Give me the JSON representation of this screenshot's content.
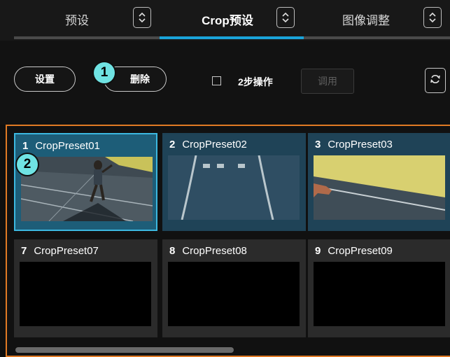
{
  "tabs": [
    {
      "label": "预设"
    },
    {
      "label": "Crop预设",
      "active": true
    },
    {
      "label": "图像调整"
    }
  ],
  "toolbar": {
    "settings_label": "设置",
    "delete_label": "删除",
    "two_step_label": "2步操作",
    "two_step_checked": false,
    "call_label": "调用"
  },
  "callouts": [
    "1",
    "2"
  ],
  "presets": [
    {
      "number": "1",
      "name": "CropPreset01",
      "selected": true,
      "thumbnail": "sprinter-start"
    },
    {
      "number": "2",
      "name": "CropPreset02",
      "thumbnail": "track-lanes"
    },
    {
      "number": "3",
      "name": "CropPreset03",
      "thumbnail": "track-closeup"
    },
    {
      "number": "7",
      "name": "CropPreset07",
      "thumbnail": "empty"
    },
    {
      "number": "8",
      "name": "CropPreset08",
      "thumbnail": "empty"
    },
    {
      "number": "9",
      "name": "CropPreset09",
      "thumbnail": "empty"
    }
  ],
  "colors": {
    "accent": "#1aa3d9",
    "callout": "#6fe3e3",
    "panel_border": "#e07a24",
    "selected_card": "#1d5d78"
  },
  "icons": [
    "stepper-icon",
    "refresh-icon"
  ]
}
